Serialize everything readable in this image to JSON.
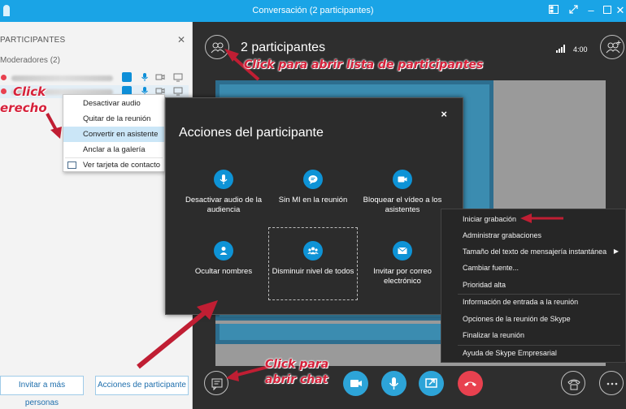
{
  "window": {
    "title": "Conversación (2 participantes)"
  },
  "left_panel": {
    "header": "PARTICIPANTES",
    "moderators_label": "Moderadores (2)",
    "invite_button": "Invitar a más personas",
    "actions_button": "Acciones de participante"
  },
  "context_menu": {
    "items": [
      "Desactivar audio",
      "Quitar de la reunión",
      "Convertir en asistente",
      "Anclar a la galería",
      "Ver tarjeta de contacto"
    ]
  },
  "stage": {
    "title": "2 participantes",
    "time": "4:00"
  },
  "dialog": {
    "title": "Acciones del participante",
    "close": "×",
    "actions": [
      {
        "label": "Desactivar audio de la audiencia",
        "icon": "microphone-icon"
      },
      {
        "label": "Sin MI en la reunión",
        "icon": "chat-bubble-icon"
      },
      {
        "label": "Bloquear el vídeo a los asistentes",
        "icon": "video-camera-icon"
      },
      {
        "label": "Ocultar nombres",
        "icon": "person-icon"
      },
      {
        "label": "Disminuir nivel de todos",
        "icon": "group-icon"
      },
      {
        "label": "Invitar por correo electrónico",
        "icon": "email-icon"
      }
    ]
  },
  "more_menu": {
    "items": [
      "Iniciar grabación",
      "Administrar grabaciones",
      "Tamaño del texto de mensajería instantánea",
      "Cambiar fuente...",
      "Prioridad alta",
      "Información de entrada a la reunión",
      "Opciones de la reunión de Skype",
      "Finalizar la reunión",
      "Ayuda de Skype Empresarial"
    ]
  },
  "annotations": {
    "participants_list": "Click para abrir lista de participantes",
    "right_click_line1": "Click",
    "right_click_line2": "erecho",
    "open_chat_line1": "Click para",
    "open_chat_line2": "abrir chat"
  },
  "colors": {
    "titlebar": "#1aa4e6",
    "accent_blue": "#0e93d6",
    "hangup_red": "#e8414f",
    "annotation_red": "#d6213a"
  }
}
